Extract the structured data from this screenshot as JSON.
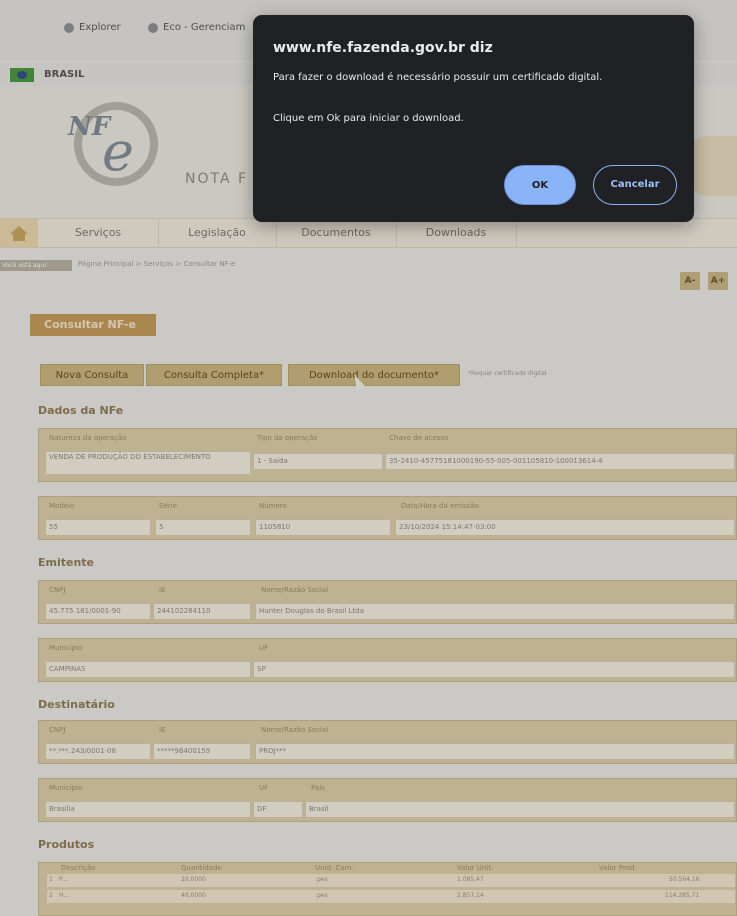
{
  "browser": {
    "favorites": [
      {
        "label": "Explorer"
      },
      {
        "label": "Eco - Gerenciam"
      }
    ]
  },
  "gov_bar": {
    "country": "BRASIL"
  },
  "banner": {
    "nota_text": "NOTA F"
  },
  "nav": {
    "items": [
      "Serviços",
      "Legislação",
      "Documentos",
      "Downloads"
    ]
  },
  "breadcrumb": {
    "tag": "Você está aqui:",
    "path": "Página Principal > Serviços > Consultar NF-e"
  },
  "font_buttons": [
    "A-",
    "A+"
  ],
  "page_title": "Consultar NF-e",
  "actions": {
    "nova": "Nova Consulta",
    "completa": "Consulta Completa*",
    "download": "Download do documento*",
    "note": "*Requer certificado digital"
  },
  "dados": {
    "heading": "Dados da NFe",
    "natureza_label": "Natureza da operação",
    "natureza_value": "VENDA DE PRODUÇÃO DO ESTABELECIMENTO",
    "tipo_label": "Tipo da operação",
    "tipo_value": "1 - Saída",
    "chave_label": "Chave de acesso",
    "chave_value": "35-2410-45775181000190-55-005-001105810-100013614-4",
    "modelo_label": "Modelo",
    "modelo_value": "55",
    "serie_label": "Série",
    "serie_value": "5",
    "numero_label": "Número",
    "numero_value": "1105810",
    "data_label": "Data/Hora da emissão",
    "data_value": "23/10/2024 15:14:47-03:00"
  },
  "emitente": {
    "heading": "Emitente",
    "cnpj_label": "CNPJ",
    "cnpj_value": "45.775.181/0001-90",
    "ie_label": "IE",
    "ie_value": "244102284110",
    "nome_label": "Nome/Razão Social",
    "nome_value": "Hunter Douglas do Brasil Ltda",
    "municipio_label": "Município",
    "municipio_value": "CAMPINAS",
    "uf_label": "UF",
    "uf_value": "SP"
  },
  "destinatario": {
    "heading": "Destinatário",
    "cnpj_label": "CNPJ",
    "cnpj_value": "**.***.243/0001-08",
    "ie_label": "IE",
    "ie_value": "*****96400159",
    "nome_label": "Nome/Razão Social",
    "nome_value": "PROJ***",
    "municipio_label": "Município",
    "municipio_value": "Brasília",
    "uf_label": "UF",
    "uf_value": "DF",
    "pais_label": "País",
    "pais_value": "Brasil"
  },
  "produtos": {
    "heading": "Produtos",
    "columns": [
      "Descrição",
      "Quantidade",
      "Unid. Com.",
      "Valor Unit.",
      "Valor Prod."
    ],
    "rows": [
      {
        "n": "1",
        "desc": "P...",
        "qtd": "20,0000",
        "unid": "pes",
        "vunit": "1.085,47",
        "vprod": "50.564,16"
      },
      {
        "n": "2",
        "desc": "H...",
        "qtd": "40,0000",
        "unid": "pes",
        "vunit": "2.857,14",
        "vprod": "114.285,71"
      }
    ]
  },
  "dialog": {
    "title": "www.nfe.fazenda.gov.br diz",
    "message1": "Para fazer o download é necessário possuir um certificado digital.",
    "message2": "Clique em Ok para iniciar o download.",
    "ok": "OK",
    "cancel": "Cancelar"
  }
}
